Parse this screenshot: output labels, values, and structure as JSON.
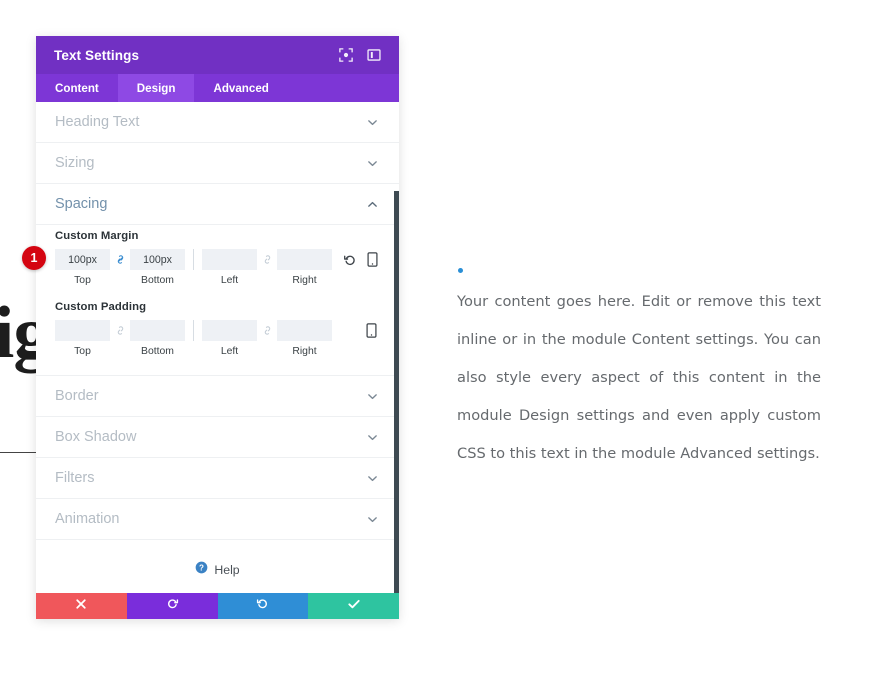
{
  "background": {
    "heading_fragment": "sig",
    "content": {
      "bullet": "bullet-dot",
      "paragraph": "Your content goes here. Edit or remove this text inline or in the module Content settings. You can also style every aspect of this content in the module Design settings and even apply custom CSS to this text in the module Advanced settings."
    }
  },
  "annotation": {
    "marker_1": "1"
  },
  "panel": {
    "title": "Text Settings",
    "header_icons": [
      {
        "name": "focus-target-icon"
      },
      {
        "name": "layout-panel-icon"
      }
    ],
    "tabs": [
      {
        "label": "Content",
        "active": false
      },
      {
        "label": "Design",
        "active": true
      },
      {
        "label": "Advanced",
        "active": false
      }
    ],
    "sections": [
      {
        "label": "Heading Text",
        "open": false
      },
      {
        "label": "Sizing",
        "open": false
      },
      {
        "label": "Spacing",
        "open": true
      },
      {
        "label": "Border",
        "open": false
      },
      {
        "label": "Box Shadow",
        "open": false
      },
      {
        "label": "Filters",
        "open": false
      },
      {
        "label": "Animation",
        "open": false
      }
    ],
    "spacing": {
      "margin": {
        "group_label": "Custom Margin",
        "top_value": "100px",
        "bottom_value": "100px",
        "left_value": "",
        "right_value": "",
        "top_label": "Top",
        "bottom_label": "Bottom",
        "left_label": "Left",
        "right_label": "Right",
        "link_tb_state": "linked",
        "link_lr_state": "unlinked",
        "reset_icon": "reset-icon",
        "device_icon": "mobile-device-icon"
      },
      "padding": {
        "group_label": "Custom Padding",
        "top_value": "",
        "bottom_value": "",
        "left_value": "",
        "right_value": "",
        "top_label": "Top",
        "bottom_label": "Bottom",
        "left_label": "Left",
        "right_label": "Right",
        "link_tb_state": "unlinked",
        "link_lr_state": "unlinked",
        "device_icon": "mobile-device-icon"
      }
    },
    "help": {
      "label": "Help",
      "icon": "help-circle-icon"
    },
    "footer_buttons": [
      {
        "name": "close-button",
        "icon": "close-x-icon",
        "color": "#f0575b"
      },
      {
        "name": "undo-button",
        "icon": "undo-arrow-icon",
        "color": "#7a2ddb"
      },
      {
        "name": "redo-button",
        "icon": "redo-arrow-icon",
        "color": "#2f8ed6"
      },
      {
        "name": "save-button",
        "icon": "checkmark-icon",
        "color": "#2ec4a0"
      }
    ]
  }
}
